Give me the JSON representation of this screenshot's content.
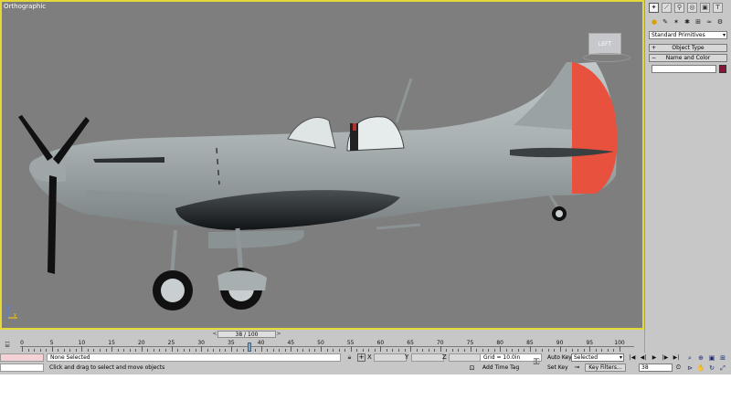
{
  "viewport": {
    "label": "Orthographic",
    "viewcube_label": "LEFT"
  },
  "command_panel": {
    "tabs": [
      {
        "name": "create",
        "glyph": "✦"
      },
      {
        "name": "modify",
        "glyph": "⟋"
      },
      {
        "name": "hierarchy",
        "glyph": "⚲"
      },
      {
        "name": "motion",
        "glyph": "◎"
      },
      {
        "name": "display",
        "glyph": "▣"
      },
      {
        "name": "utilities",
        "glyph": "T"
      }
    ],
    "subtabs": [
      {
        "name": "geometry",
        "glyph": "●"
      },
      {
        "name": "shapes",
        "glyph": "✎"
      },
      {
        "name": "lights",
        "glyph": "✶"
      },
      {
        "name": "cameras",
        "glyph": "✱"
      },
      {
        "name": "helpers",
        "glyph": "⊞"
      },
      {
        "name": "space-warps",
        "glyph": "≈"
      },
      {
        "name": "systems",
        "glyph": "⚙"
      }
    ],
    "primitives_select": "Standard Primitives",
    "object_type_rollout": "Object Type",
    "object_type_sign": "+",
    "name_color_rollout": "Name and Color",
    "name_color_sign": "−",
    "object_name": "",
    "object_color": "#8a1538"
  },
  "time_slider": {
    "label": "38 / 100",
    "prev": "<",
    "next": ">"
  },
  "trackbar": {
    "ticks": [
      "0",
      "5",
      "10",
      "15",
      "20",
      "25",
      "30",
      "35",
      "40",
      "45",
      "50",
      "55",
      "60",
      "65",
      "70",
      "75",
      "80",
      "85",
      "90",
      "95",
      "100"
    ],
    "current_frame": 38
  },
  "status": {
    "selection": "None Selected",
    "prompt": "Click and drag to select and move objects",
    "x_label": "X",
    "y_label": "Y",
    "z_label": "Z",
    "x_value": "",
    "y_value": "",
    "z_value": "",
    "grid": "Grid = 10.0in",
    "add_time_tag": "Add Time Tag",
    "auto_key": "Auto Key",
    "set_key": "Set Key",
    "key_mode": "Selected",
    "key_filters": "Key Filters...",
    "current_frame": "38"
  },
  "playback": [
    {
      "name": "go-to-start",
      "glyph": "|◀"
    },
    {
      "name": "previous-frame",
      "glyph": "◀|"
    },
    {
      "name": "play",
      "glyph": "▶"
    },
    {
      "name": "next-frame",
      "glyph": "|▶"
    },
    {
      "name": "go-to-end",
      "glyph": "▶|"
    }
  ],
  "navigation": [
    {
      "name": "zoom",
      "glyph": "⌕"
    },
    {
      "name": "zoom-all",
      "glyph": "⊕"
    },
    {
      "name": "zoom-extents",
      "glyph": "▣"
    },
    {
      "name": "zoom-extents-all",
      "glyph": "⊞"
    },
    {
      "name": "field-of-view",
      "glyph": "⊳"
    },
    {
      "name": "pan",
      "glyph": "✋"
    },
    {
      "name": "orbit",
      "glyph": "↻"
    },
    {
      "name": "maximize-viewport",
      "glyph": "⤢"
    }
  ]
}
